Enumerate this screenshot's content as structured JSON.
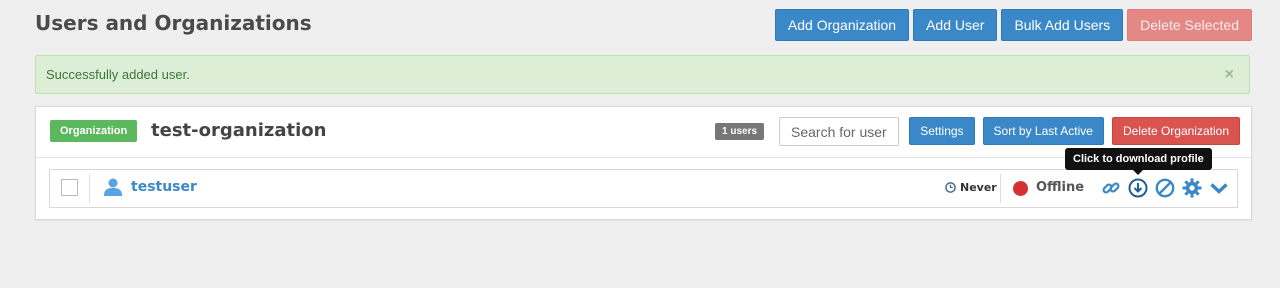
{
  "page": {
    "title": "Users and Organizations"
  },
  "header_buttons": {
    "add_organization": "Add Organization",
    "add_user": "Add User",
    "bulk_add_users": "Bulk Add Users",
    "delete_selected": "Delete Selected"
  },
  "alert": {
    "message": "Successfully added user.",
    "close": "×"
  },
  "organization": {
    "label": "Organization",
    "name": "test-organization",
    "user_count": "1 users",
    "search_placeholder": "Search for user",
    "settings": "Settings",
    "sort": "Sort by Last Active",
    "delete": "Delete Organization"
  },
  "users": [
    {
      "name": "testuser",
      "last_active": "Never",
      "status": "Offline",
      "status_color": "#d62f2f"
    }
  ],
  "tooltip": "Click to download profile",
  "icons": {
    "user": "user-icon",
    "clock": "clock-icon",
    "link": "link-icon",
    "download": "download-icon",
    "disable": "disable-icon",
    "settings": "gear-icon",
    "expand": "chevron-down-icon"
  },
  "colors": {
    "primary": "#3b88c8",
    "danger": "#d9534f",
    "success_label": "#5cb85c",
    "alert_bg": "#dcefd6"
  }
}
